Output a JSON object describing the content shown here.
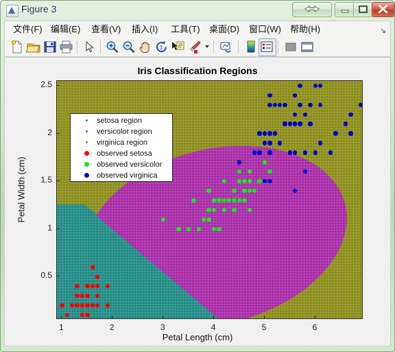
{
  "window": {
    "title": "Figure 3",
    "icon": "matlab-figure-icon",
    "buttons": [
      {
        "name": "help-restore-button",
        "glyph": "double-arrow-icon"
      },
      {
        "name": "minimize-button",
        "glyph": "minimize-icon"
      },
      {
        "name": "maximize-button",
        "glyph": "maximize-icon"
      },
      {
        "name": "close-button",
        "glyph": "close-icon"
      }
    ]
  },
  "menubar": {
    "items": [
      {
        "label": "文件(F)",
        "name": "menu-file"
      },
      {
        "label": "编辑(E)",
        "name": "menu-edit"
      },
      {
        "label": "查看(V)",
        "name": "menu-view"
      },
      {
        "label": "插入(I)",
        "name": "menu-insert"
      },
      {
        "label": "工具(T)",
        "name": "menu-tools"
      },
      {
        "label": "桌面(D)",
        "name": "menu-desktop"
      },
      {
        "label": "窗口(W)",
        "name": "menu-window"
      },
      {
        "label": "帮助(H)",
        "name": "menu-help"
      }
    ],
    "overflow": "↘"
  },
  "toolbar": {
    "buttons": [
      {
        "name": "new-figure-icon"
      },
      {
        "name": "open-file-icon"
      },
      {
        "name": "save-figure-icon"
      },
      {
        "name": "print-figure-icon"
      },
      {
        "name": "pointer-select-icon"
      },
      {
        "name": "zoom-in-icon"
      },
      {
        "name": "zoom-out-icon"
      },
      {
        "name": "pan-hand-icon"
      },
      {
        "name": "rotate-3d-icon"
      },
      {
        "name": "data-cursor-icon"
      },
      {
        "name": "brush-data-icon"
      },
      {
        "name": "brush-dropdown-caret-icon"
      },
      {
        "name": "link-plot-icon"
      },
      {
        "name": "insert-colorbar-icon"
      },
      {
        "name": "insert-legend-icon"
      },
      {
        "name": "hide-plot-tools-icon"
      },
      {
        "name": "show-plot-tools-icon"
      }
    ]
  },
  "chart_data": {
    "type": "scatter",
    "title": "Iris Classification Regions",
    "xlabel": "Petal Length (cm)",
    "ylabel": "Petal Width (cm)",
    "xlim": [
      0.9,
      6.95
    ],
    "ylim": [
      0.05,
      2.55
    ],
    "xticks": [
      1,
      2,
      3,
      4,
      5,
      6
    ],
    "yticks": [
      0.5,
      1,
      1.5,
      2,
      2.5
    ],
    "grid": false,
    "legend_position": "upper-left",
    "colors": {
      "setosa_region": "#1f8a85",
      "versicolor_region": "#a82aa8",
      "virginica_region": "#8a8c18",
      "observed_setosa": "#ff0000",
      "observed_versicolor": "#19e619",
      "observed_virginica": "#0000cc"
    },
    "legend": [
      {
        "label": "setosa region",
        "marker": "small-dot",
        "color": "#1f8a85"
      },
      {
        "label": "versicolor region",
        "marker": "small-dot",
        "color": "#a82aa8"
      },
      {
        "label": "virginica region",
        "marker": "small-dot",
        "color": "#8a8c18"
      },
      {
        "label": "observed setosa",
        "marker": "dot",
        "color": "#ff0000"
      },
      {
        "label": "observed versicolor",
        "marker": "dot",
        "color": "#19e619"
      },
      {
        "label": "observed virginica",
        "marker": "dot",
        "color": "#0000cc"
      }
    ],
    "series": [
      {
        "name": "observed setosa",
        "color": "#ff0000",
        "points": [
          [
            1.4,
            0.2
          ],
          [
            1.4,
            0.2
          ],
          [
            1.3,
            0.2
          ],
          [
            1.5,
            0.2
          ],
          [
            1.4,
            0.2
          ],
          [
            1.7,
            0.4
          ],
          [
            1.4,
            0.3
          ],
          [
            1.5,
            0.2
          ],
          [
            1.4,
            0.2
          ],
          [
            1.5,
            0.1
          ],
          [
            1.5,
            0.2
          ],
          [
            1.6,
            0.2
          ],
          [
            1.4,
            0.1
          ],
          [
            1.1,
            0.1
          ],
          [
            1.2,
            0.2
          ],
          [
            1.5,
            0.4
          ],
          [
            1.3,
            0.4
          ],
          [
            1.4,
            0.3
          ],
          [
            1.7,
            0.3
          ],
          [
            1.5,
            0.3
          ],
          [
            1.7,
            0.2
          ],
          [
            1.5,
            0.4
          ],
          [
            1.0,
            0.2
          ],
          [
            1.7,
            0.5
          ],
          [
            1.9,
            0.2
          ],
          [
            1.6,
            0.2
          ],
          [
            1.6,
            0.4
          ],
          [
            1.5,
            0.2
          ],
          [
            1.4,
            0.2
          ],
          [
            1.6,
            0.2
          ],
          [
            1.6,
            0.2
          ],
          [
            1.5,
            0.4
          ],
          [
            1.5,
            0.1
          ],
          [
            1.4,
            0.2
          ],
          [
            1.5,
            0.2
          ],
          [
            1.2,
            0.2
          ],
          [
            1.3,
            0.2
          ],
          [
            1.4,
            0.1
          ],
          [
            1.3,
            0.2
          ],
          [
            1.5,
            0.2
          ],
          [
            1.3,
            0.3
          ],
          [
            1.3,
            0.3
          ],
          [
            1.3,
            0.2
          ],
          [
            1.6,
            0.6
          ],
          [
            1.9,
            0.4
          ],
          [
            1.4,
            0.3
          ],
          [
            1.6,
            0.2
          ],
          [
            1.4,
            0.2
          ],
          [
            1.5,
            0.2
          ],
          [
            1.4,
            0.2
          ]
        ]
      },
      {
        "name": "observed versicolor",
        "color": "#19e619",
        "points": [
          [
            4.7,
            1.4
          ],
          [
            4.5,
            1.5
          ],
          [
            4.9,
            1.5
          ],
          [
            4.0,
            1.3
          ],
          [
            4.6,
            1.5
          ],
          [
            4.5,
            1.3
          ],
          [
            4.7,
            1.6
          ],
          [
            3.3,
            1.0
          ],
          [
            4.6,
            1.3
          ],
          [
            3.9,
            1.4
          ],
          [
            3.5,
            1.0
          ],
          [
            4.2,
            1.5
          ],
          [
            4.0,
            1.0
          ],
          [
            4.7,
            1.4
          ],
          [
            3.6,
            1.3
          ],
          [
            4.4,
            1.4
          ],
          [
            4.5,
            1.5
          ],
          [
            4.1,
            1.0
          ],
          [
            4.5,
            1.5
          ],
          [
            3.9,
            1.1
          ],
          [
            4.8,
            1.8
          ],
          [
            4.0,
            1.3
          ],
          [
            4.9,
            1.5
          ],
          [
            4.7,
            1.2
          ],
          [
            4.3,
            1.3
          ],
          [
            4.4,
            1.4
          ],
          [
            4.8,
            1.4
          ],
          [
            5.0,
            1.7
          ],
          [
            4.5,
            1.5
          ],
          [
            3.5,
            1.0
          ],
          [
            3.8,
            1.1
          ],
          [
            3.7,
            1.0
          ],
          [
            3.9,
            1.2
          ],
          [
            5.1,
            1.6
          ],
          [
            4.5,
            1.5
          ],
          [
            4.5,
            1.6
          ],
          [
            4.7,
            1.5
          ],
          [
            4.4,
            1.3
          ],
          [
            4.1,
            1.3
          ],
          [
            4.0,
            1.3
          ],
          [
            4.4,
            1.2
          ],
          [
            4.6,
            1.4
          ],
          [
            4.0,
            1.2
          ],
          [
            3.3,
            1.0
          ],
          [
            4.2,
            1.3
          ],
          [
            4.2,
            1.2
          ],
          [
            4.2,
            1.3
          ],
          [
            4.3,
            1.3
          ],
          [
            3.0,
            1.1
          ],
          [
            4.1,
            1.3
          ]
        ]
      },
      {
        "name": "observed virginica",
        "color": "#0000cc",
        "points": [
          [
            6.0,
            2.5
          ],
          [
            5.1,
            1.9
          ],
          [
            5.9,
            2.1
          ],
          [
            5.6,
            1.8
          ],
          [
            5.8,
            2.2
          ],
          [
            6.6,
            2.1
          ],
          [
            4.5,
            1.7
          ],
          [
            6.3,
            1.8
          ],
          [
            5.8,
            1.8
          ],
          [
            6.1,
            2.5
          ],
          [
            5.1,
            2.0
          ],
          [
            5.3,
            1.9
          ],
          [
            5.5,
            2.1
          ],
          [
            5.0,
            2.0
          ],
          [
            5.1,
            2.4
          ],
          [
            5.3,
            2.3
          ],
          [
            5.5,
            1.8
          ],
          [
            6.7,
            2.2
          ],
          [
            6.9,
            2.3
          ],
          [
            5.0,
            1.5
          ],
          [
            5.7,
            2.3
          ],
          [
            4.9,
            2.0
          ],
          [
            6.7,
            2.0
          ],
          [
            4.9,
            1.8
          ],
          [
            5.7,
            2.1
          ],
          [
            6.0,
            1.8
          ],
          [
            4.8,
            1.8
          ],
          [
            4.9,
            1.8
          ],
          [
            5.6,
            2.1
          ],
          [
            5.8,
            1.6
          ],
          [
            6.1,
            1.9
          ],
          [
            6.4,
            2.0
          ],
          [
            5.6,
            2.2
          ],
          [
            5.1,
            1.5
          ],
          [
            5.6,
            1.4
          ],
          [
            6.1,
            2.3
          ],
          [
            5.6,
            2.4
          ],
          [
            5.5,
            1.8
          ],
          [
            4.8,
            1.8
          ],
          [
            5.4,
            2.1
          ],
          [
            5.6,
            2.4
          ],
          [
            5.1,
            2.3
          ],
          [
            5.1,
            1.9
          ],
          [
            5.9,
            2.3
          ],
          [
            5.7,
            2.5
          ],
          [
            5.2,
            2.3
          ],
          [
            5.0,
            1.9
          ],
          [
            5.2,
            2.0
          ],
          [
            5.4,
            2.3
          ],
          [
            5.1,
            1.8
          ]
        ]
      }
    ],
    "regions_description": {
      "setosa": "teal region in lower-left, bounded above by y≈1.45 and by a diagonal boundary running down-right",
      "versicolor": "magenta elliptical region in the centre",
      "virginica": "olive region filling the remaining upper-right background"
    }
  }
}
